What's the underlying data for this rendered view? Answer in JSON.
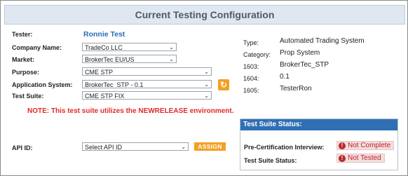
{
  "title": "Current Testing Configuration",
  "form": {
    "tester_label": "Tester:",
    "tester_value": "Ronnie Test",
    "company_label": "Company Name:",
    "company_value": "TradeCo LLC",
    "market_label": "Market:",
    "market_value": "BrokerTec EU/US",
    "purpose_label": "Purpose:",
    "purpose_value": "CME STP",
    "appsys_label": "Application System:",
    "appsys_value": "BrokerTec_STP - 0.1",
    "suite_label": "Test Suite:",
    "suite_value": "CME STP FIX",
    "note": "NOTE: This test suite utilizes the NEWRELEASE environment.",
    "apiid_label": "API ID:",
    "apiid_placeholder": "Select API ID",
    "assign_label": "ASSIGN"
  },
  "details": {
    "type_label": "Type:",
    "type_value": "Automated Trading System",
    "category_label": "Category:",
    "category_value": "Prop System",
    "f1603_label": "1603:",
    "f1603_value": "BrokerTec_STP",
    "f1604_label": "1604:",
    "f1604_value": "0.1",
    "f1605_label": "1605:",
    "f1605_value": "TesterRon"
  },
  "status": {
    "header": "Test Suite Status:",
    "interview_label": "Pre-Certification Interview:",
    "interview_value": "Not Complete",
    "suite_status_label": "Test Suite Status:",
    "suite_status_value": "Not Tested"
  },
  "colors": {
    "accent_orange": "#f3a023",
    "link_blue": "#2a6cb8",
    "header_blue": "#2f6fb3",
    "error_red": "#e12a2a"
  },
  "icons": {
    "refresh": "refresh-icon",
    "error": "exclamation-circle-icon",
    "dropdown": "chevron-down-icon"
  }
}
